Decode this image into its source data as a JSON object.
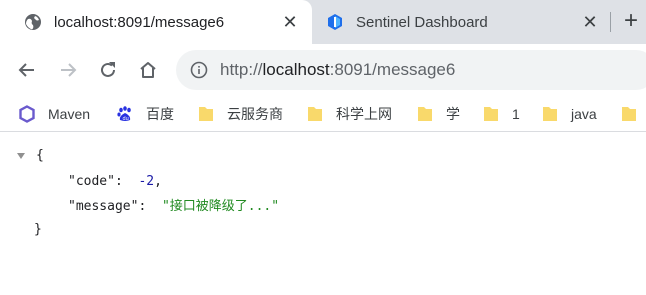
{
  "tabs": [
    {
      "title": "localhost:8091/message6",
      "active": true,
      "favicon": "globe-icon"
    },
    {
      "title": "Sentinel Dashboard",
      "active": false,
      "favicon": "sentinel-logo-icon"
    }
  ],
  "toolbar": {
    "url_scheme": "http://",
    "url_host": "localhost",
    "url_rest": ":8091/message6"
  },
  "bookmarks": [
    {
      "label": "Maven",
      "icon": "maven-hexagon-icon"
    },
    {
      "label": "百度",
      "icon": "baidu-paw-icon"
    },
    {
      "label": "云服务商",
      "icon": "folder-icon"
    },
    {
      "label": "科学上网",
      "icon": "folder-icon"
    },
    {
      "label": "学",
      "icon": "folder-icon"
    },
    {
      "label": "1",
      "icon": "folder-icon"
    },
    {
      "label": "java",
      "icon": "folder-icon"
    },
    {
      "label": "",
      "icon": "folder-icon"
    }
  ],
  "json": {
    "open_brace": "{",
    "close_brace": "}",
    "code_key": "\"code\"",
    "code_value": "-2",
    "message_key": "\"message\"",
    "message_value": "\"接口被降级了...\""
  },
  "colors": {
    "tabstrip_bg": "#dee1e6",
    "omnibox_bg": "#f1f3f4",
    "folder_yellow": "#f9d96b",
    "json_number": "#1a1aa6",
    "json_string": "#228b22"
  }
}
